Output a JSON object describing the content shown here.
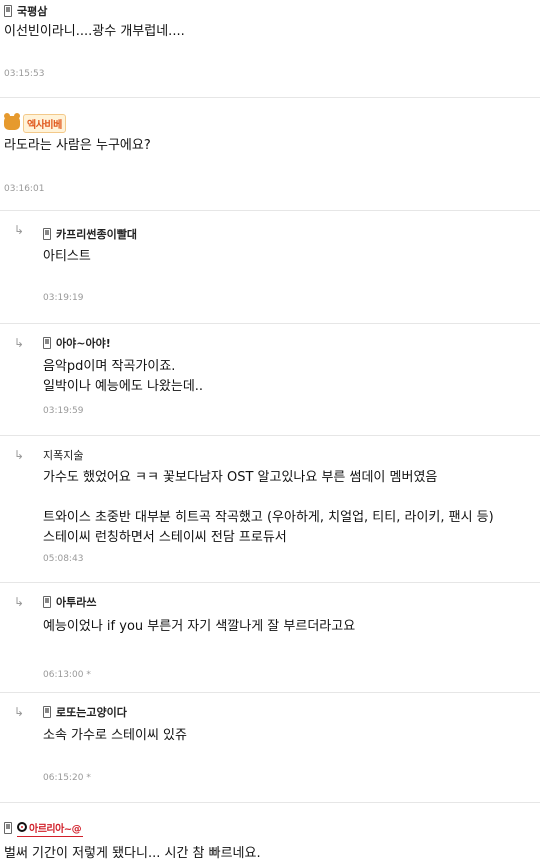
{
  "comments": [
    {
      "nick": "국평삼",
      "text": "이선빈이라니....광수 개부럽네....",
      "time": "03:15:53"
    },
    {
      "nick": "엑사비베",
      "text": "라도라는 사람은 누구에요?",
      "time": "03:16:01"
    },
    {
      "nick": "카프리썬종이빨대",
      "text": "아티스트",
      "time": "03:19:19"
    },
    {
      "nick": "아야~아야!",
      "lines": [
        "음악pd이며 작곡가이죠.",
        "일박이나 예능에도 나왔는데.."
      ],
      "time": "03:19:59"
    },
    {
      "nick": "지폭지술",
      "lines": [
        "가수도 했었어요 ㅋㅋ 꽃보다남자 OST 알고있나요 부른 썸데이 멤버였음",
        "",
        "트와이스 초중반 대부분 히트곡 작곡했고 (우아하게, 치얼업, 티티, 라이키, 팬시 등)",
        "스테이씨 런칭하면서 스테이씨 전담 프로듀서"
      ],
      "time": "05:08:43"
    },
    {
      "nick": "아투라쓰",
      "text": "예능이었나 if you 부른거 자기 색깔나게 잘 부르더라고요",
      "time": "06:13:00",
      "star": "*"
    },
    {
      "nick": "로또는고양이다",
      "text": "소속 가수로 스테이씨 있쥬",
      "time": "06:15:20",
      "star": "*"
    },
    {
      "nick": "아르리아~@",
      "text": "벌써 기간이 저렇게 됐다니... 시간 참 빠르네요."
    }
  ],
  "icons": {
    "reply": "reply-arrow-icon",
    "phone": "mobile-phone-icon",
    "bear": "bear-level-icon",
    "badge": "target-badge-icon"
  }
}
